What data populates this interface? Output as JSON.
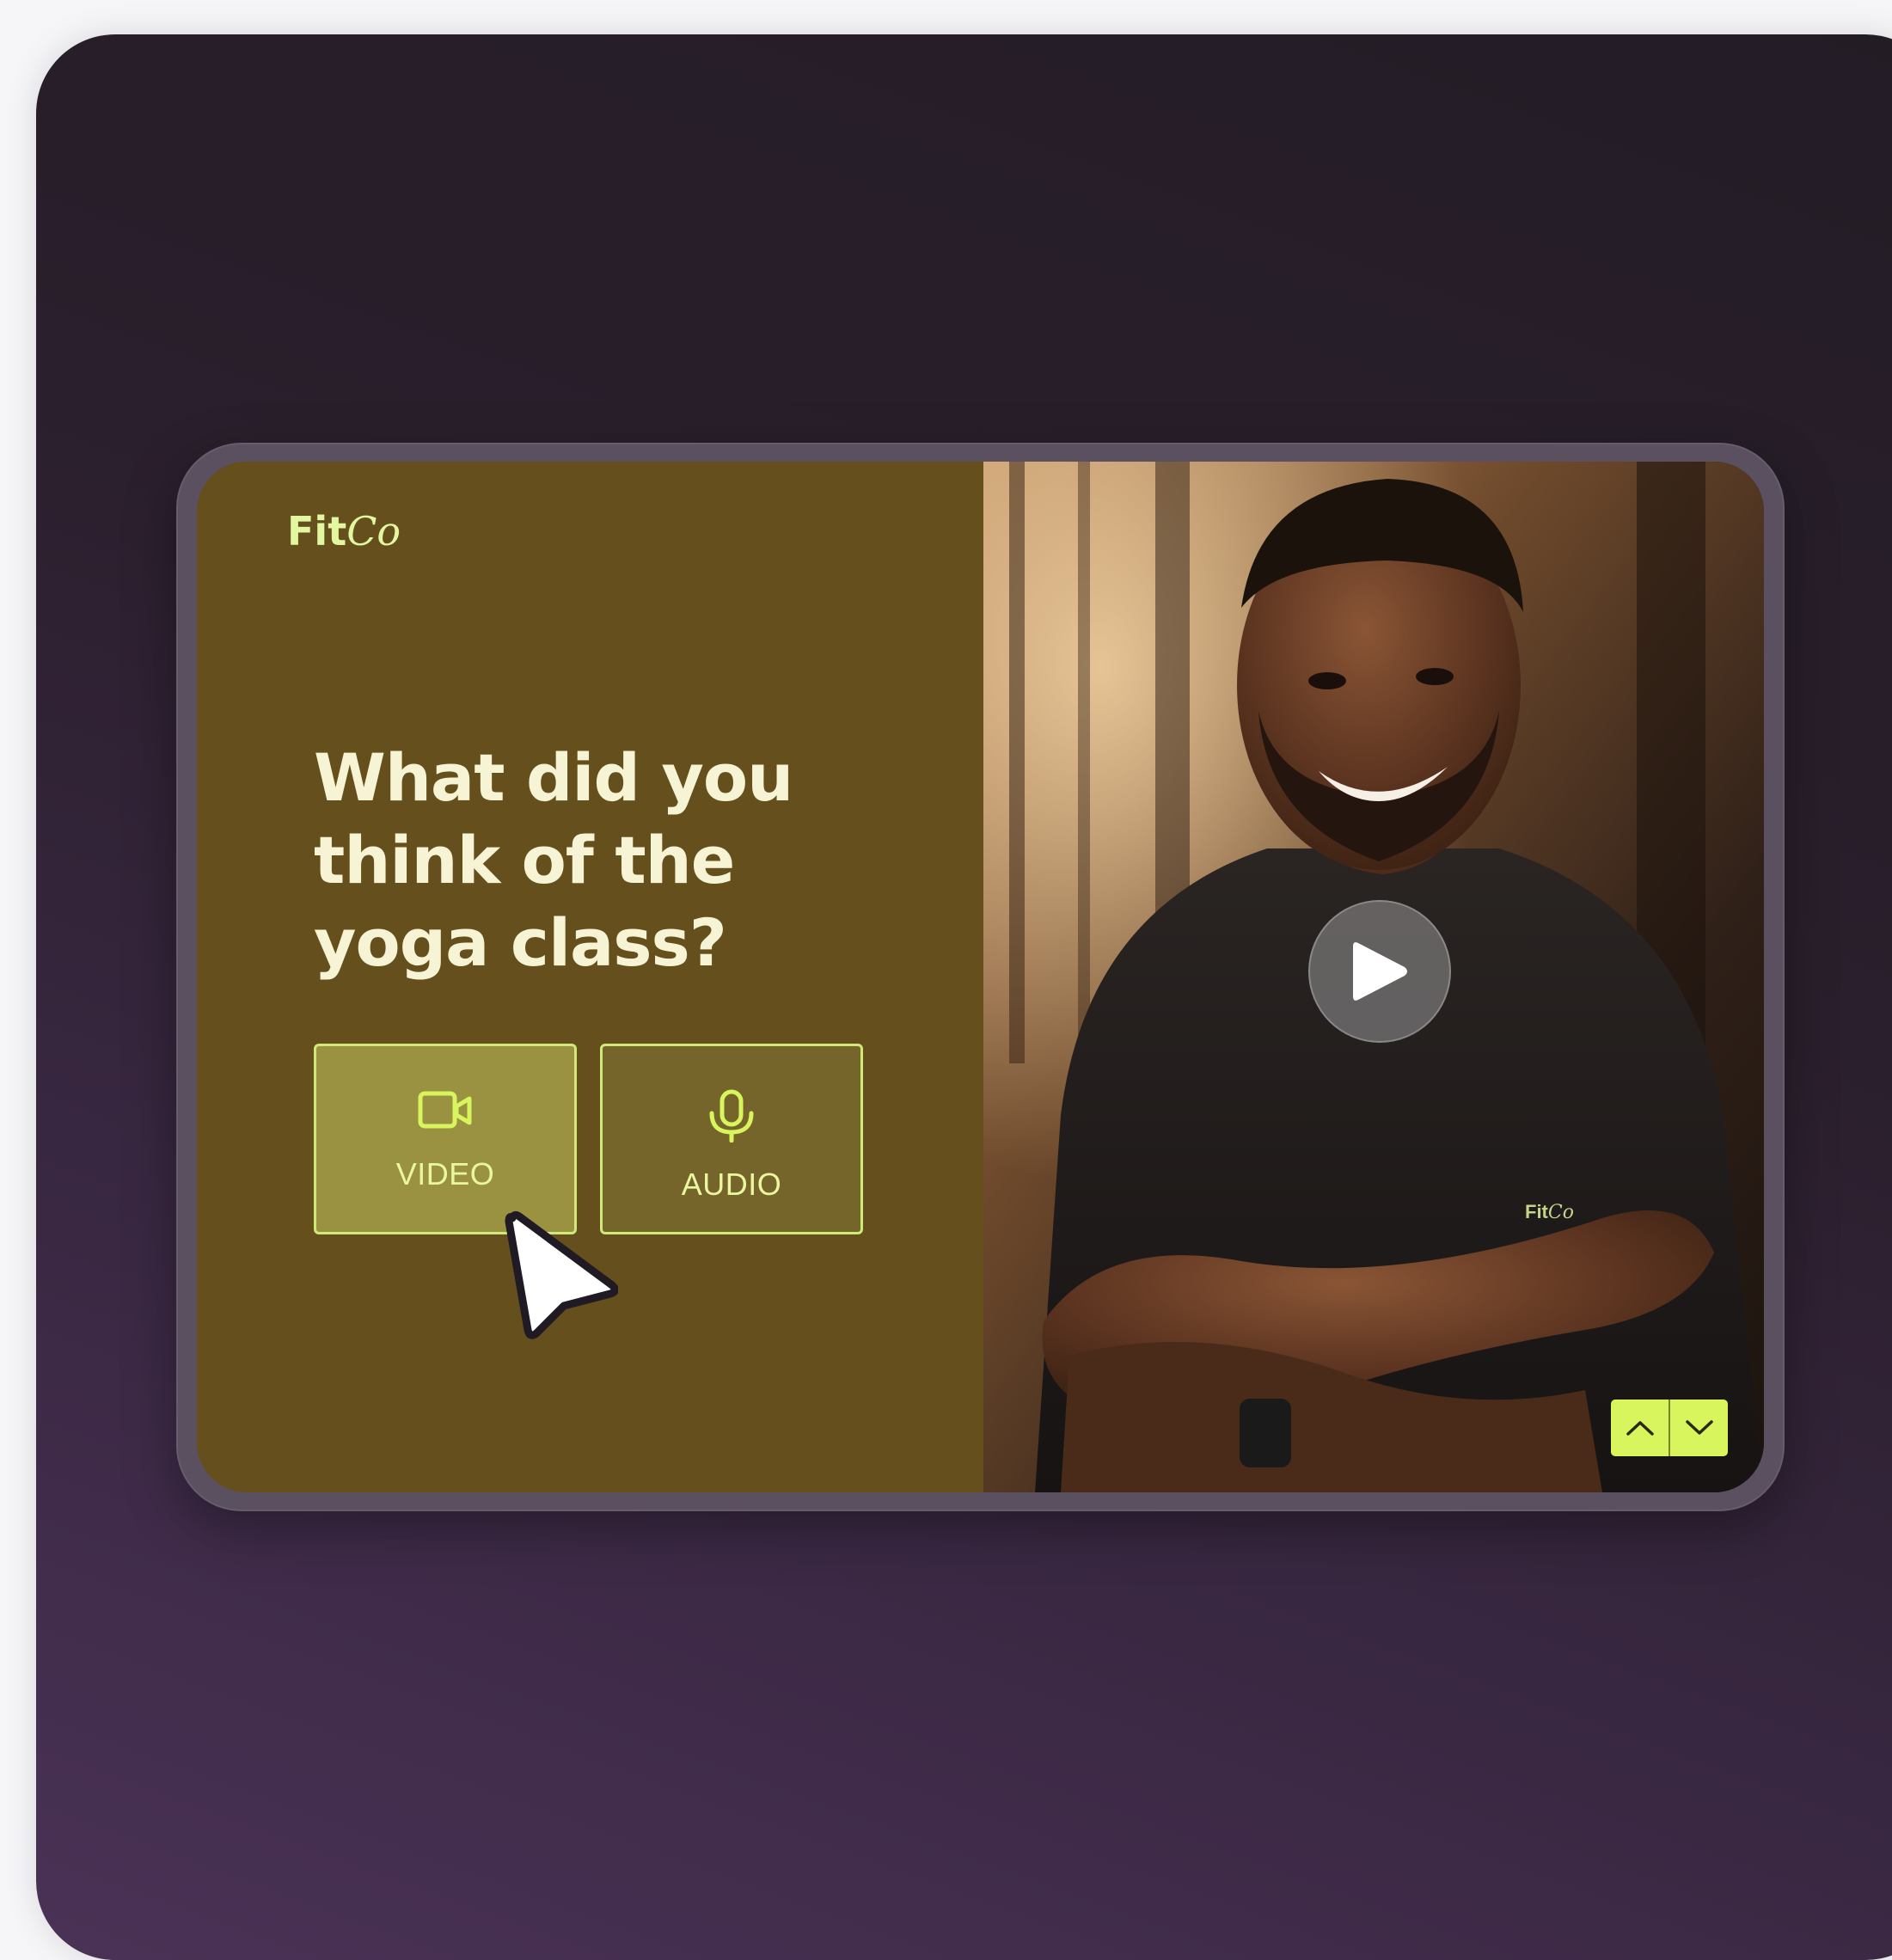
{
  "brand": {
    "name_part1": "Fit",
    "name_part2": "Co",
    "color": "#e3f6a0"
  },
  "question": {
    "text": "What did you think of the yoga class?"
  },
  "options": [
    {
      "label": "VIDEO",
      "icon": "video-camera-icon",
      "selected": true
    },
    {
      "label": "AUDIO",
      "icon": "microphone-icon",
      "selected": false
    }
  ],
  "media": {
    "image": "smiling-trainer-photo",
    "shirt_logo_part1": "Fit",
    "shirt_logo_part2": "Co",
    "play_icon": "play-icon"
  },
  "navigation": {
    "up_icon": "chevron-up-icon",
    "down_icon": "chevron-down-icon"
  },
  "colors": {
    "left_panel": "#654f1c",
    "accent": "#d8f55e",
    "question_text": "#f6f4d4",
    "selected_option": "#9a9240"
  }
}
